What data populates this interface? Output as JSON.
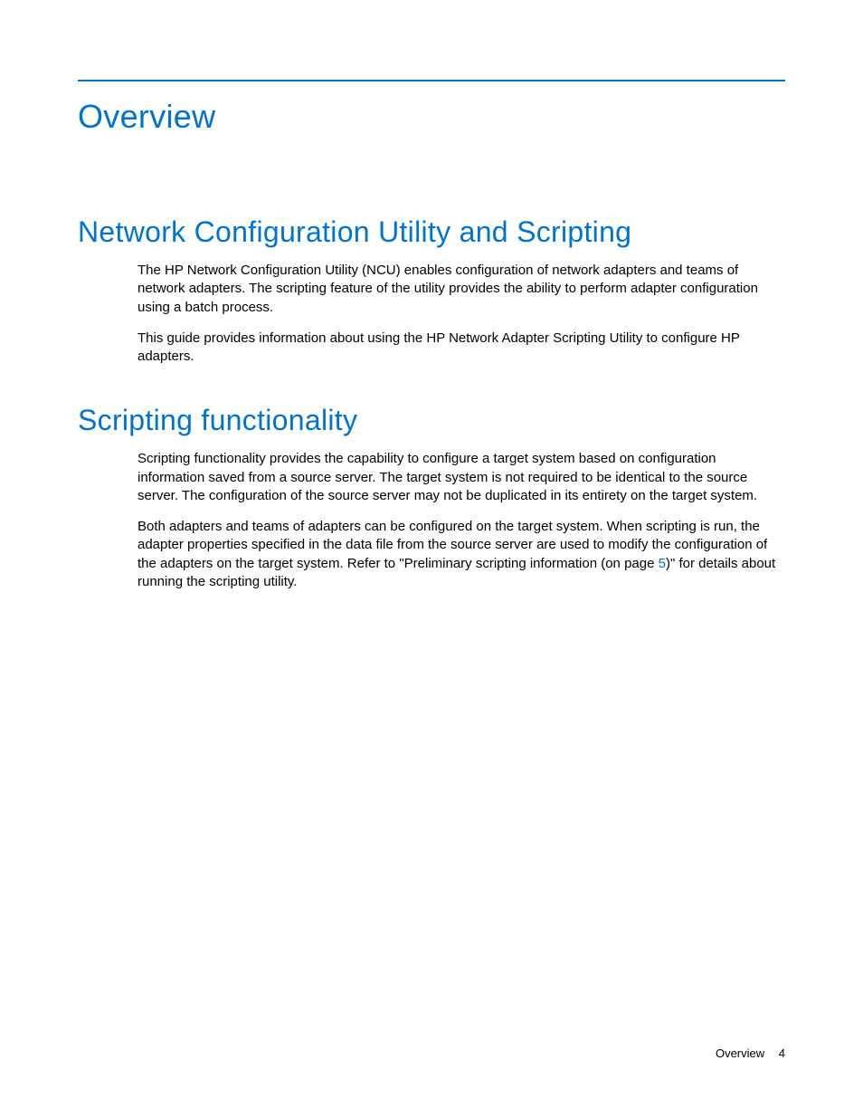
{
  "page": {
    "h1": "Overview",
    "sections": [
      {
        "h2": "Network Configuration Utility and Scripting",
        "paragraphs": [
          "The HP Network Configuration Utility (NCU) enables configuration of network adapters and teams of network adapters. The scripting feature of the utility provides the ability to perform adapter configuration using a batch process.",
          "This guide provides information about using the HP Network Adapter Scripting Utility to configure HP adapters."
        ]
      },
      {
        "h2": "Scripting functionality",
        "paragraphs": [
          "Scripting functionality provides the capability to configure a target system based on configuration information saved from a source server. The target system is not required to be identical to the source server. The configuration of the source server may not be duplicated in its entirety on the target system."
        ],
        "special_paragraph": {
          "pre": "Both adapters and teams of adapters can be configured on the target system. When scripting is run, the adapter properties specified in the data file from the source server are used to modify the configuration of the adapters on the target system. Refer to \"Preliminary scripting information (on page ",
          "link": "5",
          "post": ")\" for details about running the scripting utility."
        }
      }
    ]
  },
  "footer": {
    "section": "Overview",
    "page_number": "4"
  }
}
